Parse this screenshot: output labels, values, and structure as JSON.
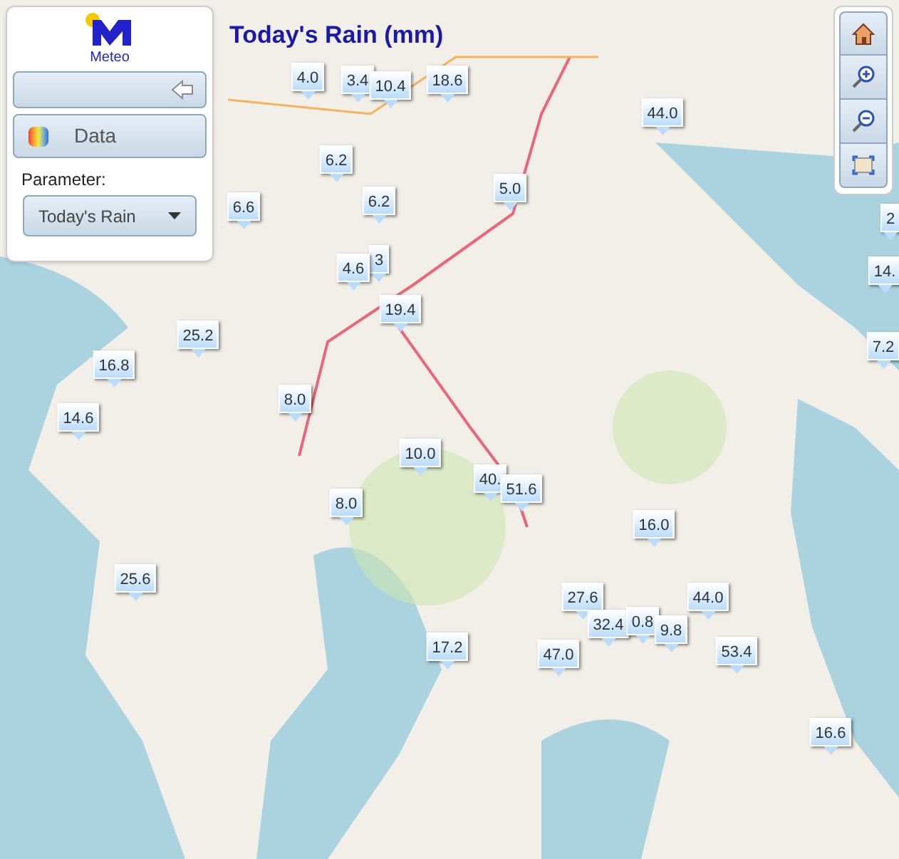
{
  "title": "Today's Rain (mm)",
  "panel": {
    "logo_text": "Meteo",
    "data_button": "Data",
    "parameter_label": "Parameter:",
    "parameter_select": "Today's Rain"
  },
  "markers": [
    {
      "value": "4.0"
    },
    {
      "value": "3.4"
    },
    {
      "value": "10.4"
    },
    {
      "value": "18.6"
    },
    {
      "value": "44.0"
    },
    {
      "value": "6.2"
    },
    {
      "value": "5.0"
    },
    {
      "value": "6.2"
    },
    {
      "value": "6.6"
    },
    {
      "value": "3"
    },
    {
      "value": "4.6"
    },
    {
      "value": "19.4"
    },
    {
      "value": "25.2"
    },
    {
      "value": "16.8"
    },
    {
      "value": "8.0"
    },
    {
      "value": "14.6"
    },
    {
      "value": "10.0"
    },
    {
      "value": "40."
    },
    {
      "value": "51.6"
    },
    {
      "value": "8.0"
    },
    {
      "value": "16.0"
    },
    {
      "value": "25.6"
    },
    {
      "value": "27.6"
    },
    {
      "value": "44.0"
    },
    {
      "value": "32.4"
    },
    {
      "value": "0.8"
    },
    {
      "value": "9.8"
    },
    {
      "value": "17.2"
    },
    {
      "value": "47.0"
    },
    {
      "value": "53.4"
    },
    {
      "value": "16.6"
    },
    {
      "value": "2"
    },
    {
      "value": "14."
    },
    {
      "value": "7.2"
    }
  ]
}
